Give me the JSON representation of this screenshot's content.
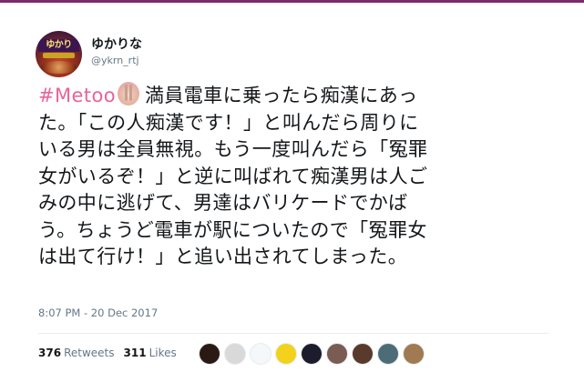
{
  "tweet": {
    "display_name": "ゆかりな",
    "handle": "@ykrn_rtj",
    "avatar_text": "ゆかり",
    "hashtag": "#Metoo",
    "emoji": "raised-hand-emoji",
    "text_lines": [
      "満員電車に乗ったら痴漢にあっ",
      "た。「この人痴漢です！」と叫んだら周りに",
      "いる男は全員無視。もう一度叫んだら「冤罪",
      "女がいるぞ！」と逆に叫ばれて痴漢男は人ご",
      "みの中に逃げて、男達はバリケードでかば",
      "う。ちょうど電車が駅についたので「冤罪女",
      "は出て行け！」と追い出されてしまった。"
    ],
    "timestamp": "8:07 PM - 20 Dec 2017"
  },
  "stats": {
    "retweets_count": "376",
    "retweets_label": "Retweets",
    "likes_count": "311",
    "likes_label": "Likes"
  },
  "likers": [
    {
      "name": "liker-avatar",
      "color": "#2b1a14"
    },
    {
      "name": "liker-avatar",
      "color": "#d9d9d9"
    },
    {
      "name": "liker-avatar",
      "color": "#f5f8fa"
    },
    {
      "name": "liker-avatar",
      "color": "#f2d21b"
    },
    {
      "name": "liker-avatar",
      "color": "#1c1c2c"
    },
    {
      "name": "liker-avatar",
      "color": "#7a5c52"
    },
    {
      "name": "liker-avatar",
      "color": "#5a3a2a"
    },
    {
      "name": "liker-avatar",
      "color": "#4e6b78"
    },
    {
      "name": "liker-avatar",
      "color": "#a07a52"
    }
  ],
  "colors": {
    "hashtag": "#e7649a",
    "top_bar": "#7b2c6e"
  }
}
